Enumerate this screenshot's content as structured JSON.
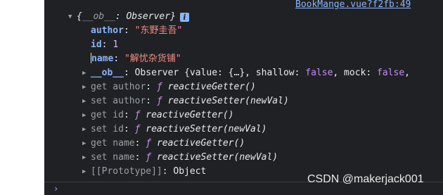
{
  "source_link": "BookMange.vue?f2fb:49",
  "object": {
    "header_prefix": "{",
    "header_key": "__ob__",
    "header_sep": ": ",
    "header_type": "Observer",
    "header_suffix": "}",
    "info_glyph": "i"
  },
  "props": [
    {
      "key": "author",
      "value": "\"东野圭吾\""
    },
    {
      "key": "id",
      "value": "1"
    },
    {
      "key": "name",
      "value": "\"解忧杂货铺\""
    }
  ],
  "ob_row": {
    "key": "__ob__",
    "text_a": "Observer {value: {…}, shallow: ",
    "shallow": "false",
    "text_b": ", mock: ",
    "mock": "false",
    "text_c": ","
  },
  "accessors": [
    {
      "label": "get author",
      "f": "ƒ",
      "fn": "reactiveGetter()"
    },
    {
      "label": "set author",
      "f": "ƒ",
      "fn": "reactiveSetter(newVal)"
    },
    {
      "label": "get id",
      "f": "ƒ",
      "fn": "reactiveGetter()"
    },
    {
      "label": "set id",
      "f": "ƒ",
      "fn": "reactiveSetter(newVal)"
    },
    {
      "label": "get name",
      "f": "ƒ",
      "fn": "reactiveGetter()"
    },
    {
      "label": "set name",
      "f": "ƒ",
      "fn": "reactiveSetter(newVal)"
    }
  ],
  "prototype_row": {
    "key": "[[Prototype]]",
    "value": "Object"
  },
  "prompt_glyph": "›",
  "watermark": "CSDN @makerjack001",
  "colors": {
    "console_bg": "#202124",
    "link": "#8ab4f8",
    "string": "#f28b82",
    "keyword": "#c58af9"
  }
}
